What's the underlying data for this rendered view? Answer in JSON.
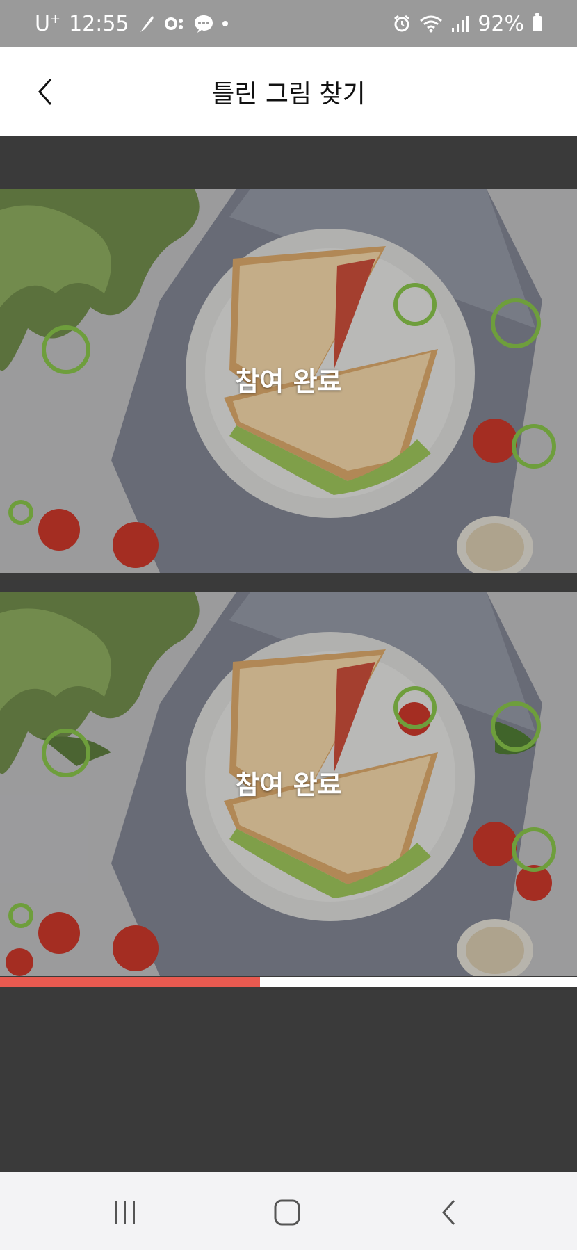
{
  "status": {
    "carrier": "U",
    "carrier_sup": "+",
    "time": "12:55",
    "battery": "92%"
  },
  "header": {
    "title": "틀린 그림 찾기"
  },
  "pictures": {
    "top": {
      "status_label": "참여 완료"
    },
    "bottom": {
      "status_label": "참여 완료"
    }
  },
  "progress": {
    "fraction": 0.45
  },
  "colors": {
    "status_bar": "#9a9a9a",
    "marker": "#6e9e3c",
    "progress_fill": "#e85a50",
    "background": "#3a3a3a"
  },
  "nav": {
    "icons": [
      "recent-apps-icon",
      "home-icon",
      "back-icon"
    ]
  }
}
